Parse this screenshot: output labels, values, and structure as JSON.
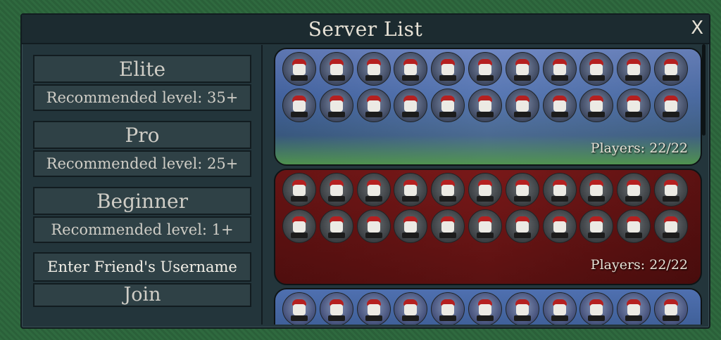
{
  "window": {
    "title": "Server List",
    "close_label": "X"
  },
  "tiers": [
    {
      "name": "Elite",
      "recommended": "Recommended level: 35+"
    },
    {
      "name": "Pro",
      "recommended": "Recommended level: 25+"
    },
    {
      "name": "Beginner",
      "recommended": "Recommended level: 1+"
    }
  ],
  "friend": {
    "label": "Enter Friend's Username",
    "join_label": "Join"
  },
  "servers": [
    {
      "players_text": "Players: 22/22",
      "player_count": 22,
      "theme": "blue-forest"
    },
    {
      "players_text": "Players: 22/22",
      "player_count": 22,
      "theme": "red-forest"
    },
    {
      "players_text": "",
      "player_count": 11,
      "theme": "blue-forest"
    }
  ],
  "colors": {
    "panel": "#23353b",
    "button": "#2f4146",
    "hat": "#b52020",
    "text": "#e7e2d6"
  }
}
